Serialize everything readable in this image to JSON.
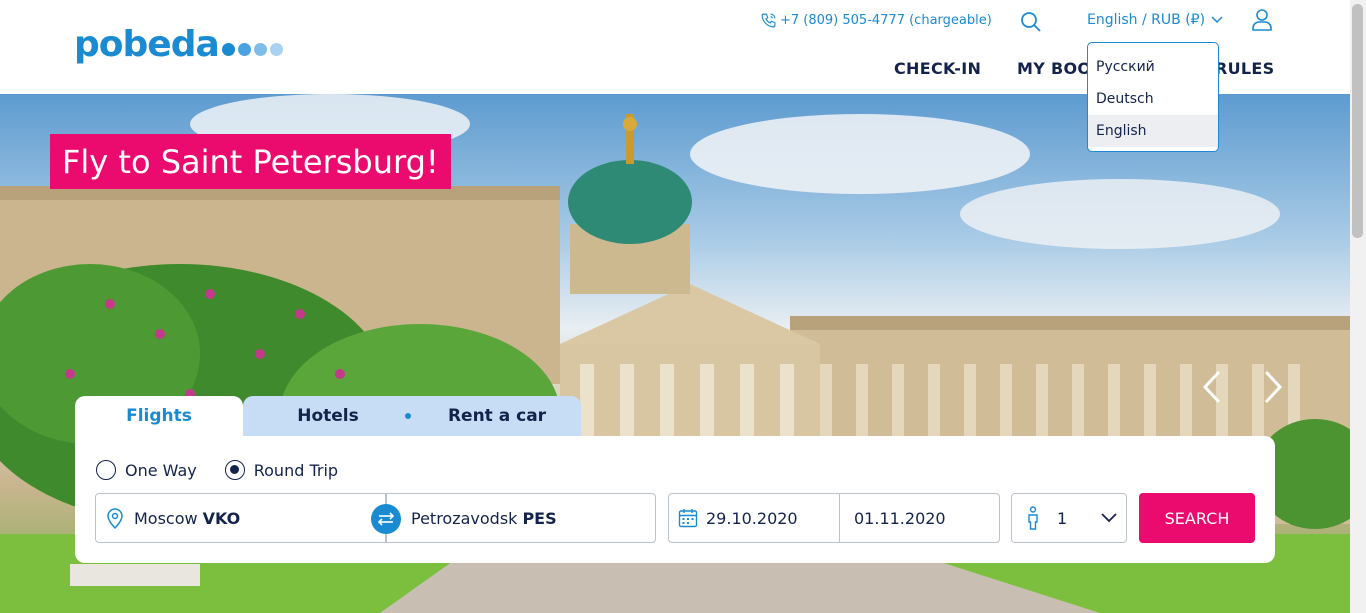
{
  "header": {
    "logo_text": "pobeda",
    "logo_dot_colors": [
      "#1a8bd1",
      "#4aa3e0",
      "#7fbde9",
      "#a9d2f1"
    ],
    "phone": "+7 (809) 505-4777 (chargeable)",
    "language_currency": "English / RUB (₽)",
    "nav": {
      "check_in": "CHECK-IN",
      "my_booking": "MY BOO",
      "rules": "RULES"
    }
  },
  "language_dropdown": {
    "options": [
      "Русский",
      "Deutsch",
      "English"
    ],
    "selected": "English"
  },
  "hero": {
    "promo_text": "Fly to Saint Petersburg!"
  },
  "booking": {
    "tabs": [
      "Flights",
      "Hotels",
      "Rent a car"
    ],
    "active_tab": "Flights",
    "trip_types": [
      "One Way",
      "Round Trip"
    ],
    "selected_trip_type": "Round Trip",
    "origin_city": "Moscow",
    "origin_code": "VKO",
    "destination_city": "Petrozavodsk",
    "destination_code": "PES",
    "depart_date": "29.10.2020",
    "return_date": "01.11.2020",
    "passengers": "1",
    "search_label": "SEARCH"
  },
  "colors": {
    "brand_blue": "#1a8bd1",
    "accent_pink": "#eb0a6e",
    "navy_text": "#14234b"
  }
}
